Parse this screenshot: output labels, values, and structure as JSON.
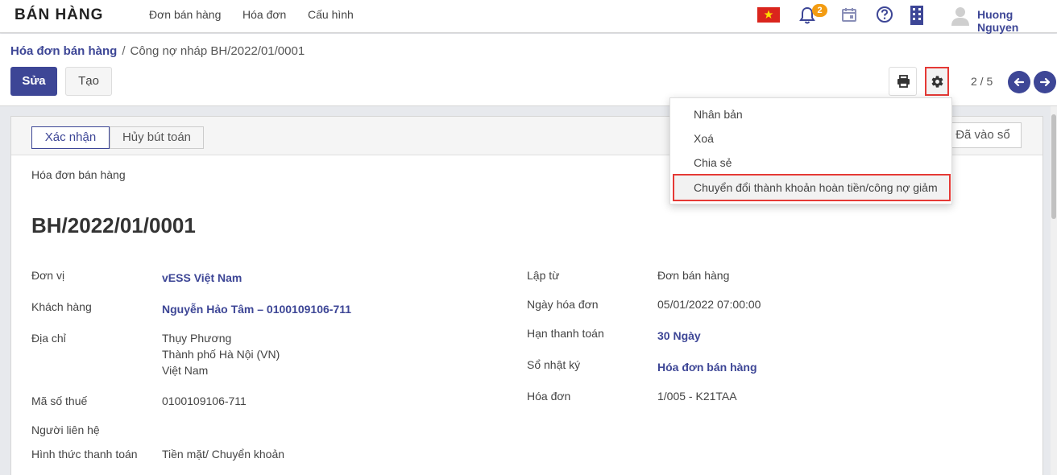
{
  "navbar": {
    "brand": "BÁN HÀNG",
    "menu": [
      "Đơn bán hàng",
      "Hóa đơn",
      "Cấu hình"
    ],
    "notification_count": "2",
    "user_name": "Huong Nguyen",
    "icons": [
      "vietnam-flag-icon",
      "bell-icon",
      "calendar-icon",
      "help-icon",
      "building-icon",
      "user-avatar-icon"
    ]
  },
  "breadcrumb": {
    "parent": "Hóa đơn bán hàng",
    "separator": "/",
    "current": "Công nợ nháp BH/2022/01/0001"
  },
  "toolbar": {
    "edit_label": "Sửa",
    "create_label": "Tạo",
    "pager": "2 / 5"
  },
  "action_menu": {
    "items": [
      "Nhân bản",
      "Xoá",
      "Chia sẻ",
      "Chuyển đổi thành khoản hoàn tiền/công nợ giảm"
    ]
  },
  "statusbar": {
    "confirm_label": "Xác nhận",
    "cancel_label": "Hủy bút toán",
    "status_label": "Đã vào sổ"
  },
  "form": {
    "doc_type": "Hóa đơn bán hàng",
    "doc_number": "BH/2022/01/0001",
    "left_fields": [
      {
        "label": "Đơn vị",
        "value": "vESS Việt Nam"
      },
      {
        "label": "Khách hàng",
        "value": "Nguyễn Hảo Tâm – 0100109106-711"
      },
      {
        "label": "Địa chỉ",
        "lines": [
          "Thụy Phương",
          "Thành phố Hà Nội (VN)",
          "Việt Nam"
        ]
      },
      {
        "label": "Mã số thuế",
        "value": "0100109106-711"
      },
      {
        "label": "Người liên hệ",
        "value": ""
      },
      {
        "label": "Hình thức thanh toán",
        "value": "Tiền mặt/ Chuyển khoản"
      }
    ],
    "right_fields": [
      {
        "label": "Lập từ",
        "value": "Đơn bán hàng"
      },
      {
        "label": "Ngày hóa đơn",
        "value": "05/01/2022 07:00:00"
      },
      {
        "label": "Hạn thanh toán",
        "value": "30 Ngày"
      },
      {
        "label": "Sổ nhật ký",
        "value": "Hóa đơn bán hàng"
      },
      {
        "label": "Hóa đơn",
        "value": "1/005 - K21TAA"
      }
    ]
  },
  "colors": {
    "primary": "#3d4696",
    "highlight_border": "#e53935",
    "badge": "#f39c12"
  }
}
